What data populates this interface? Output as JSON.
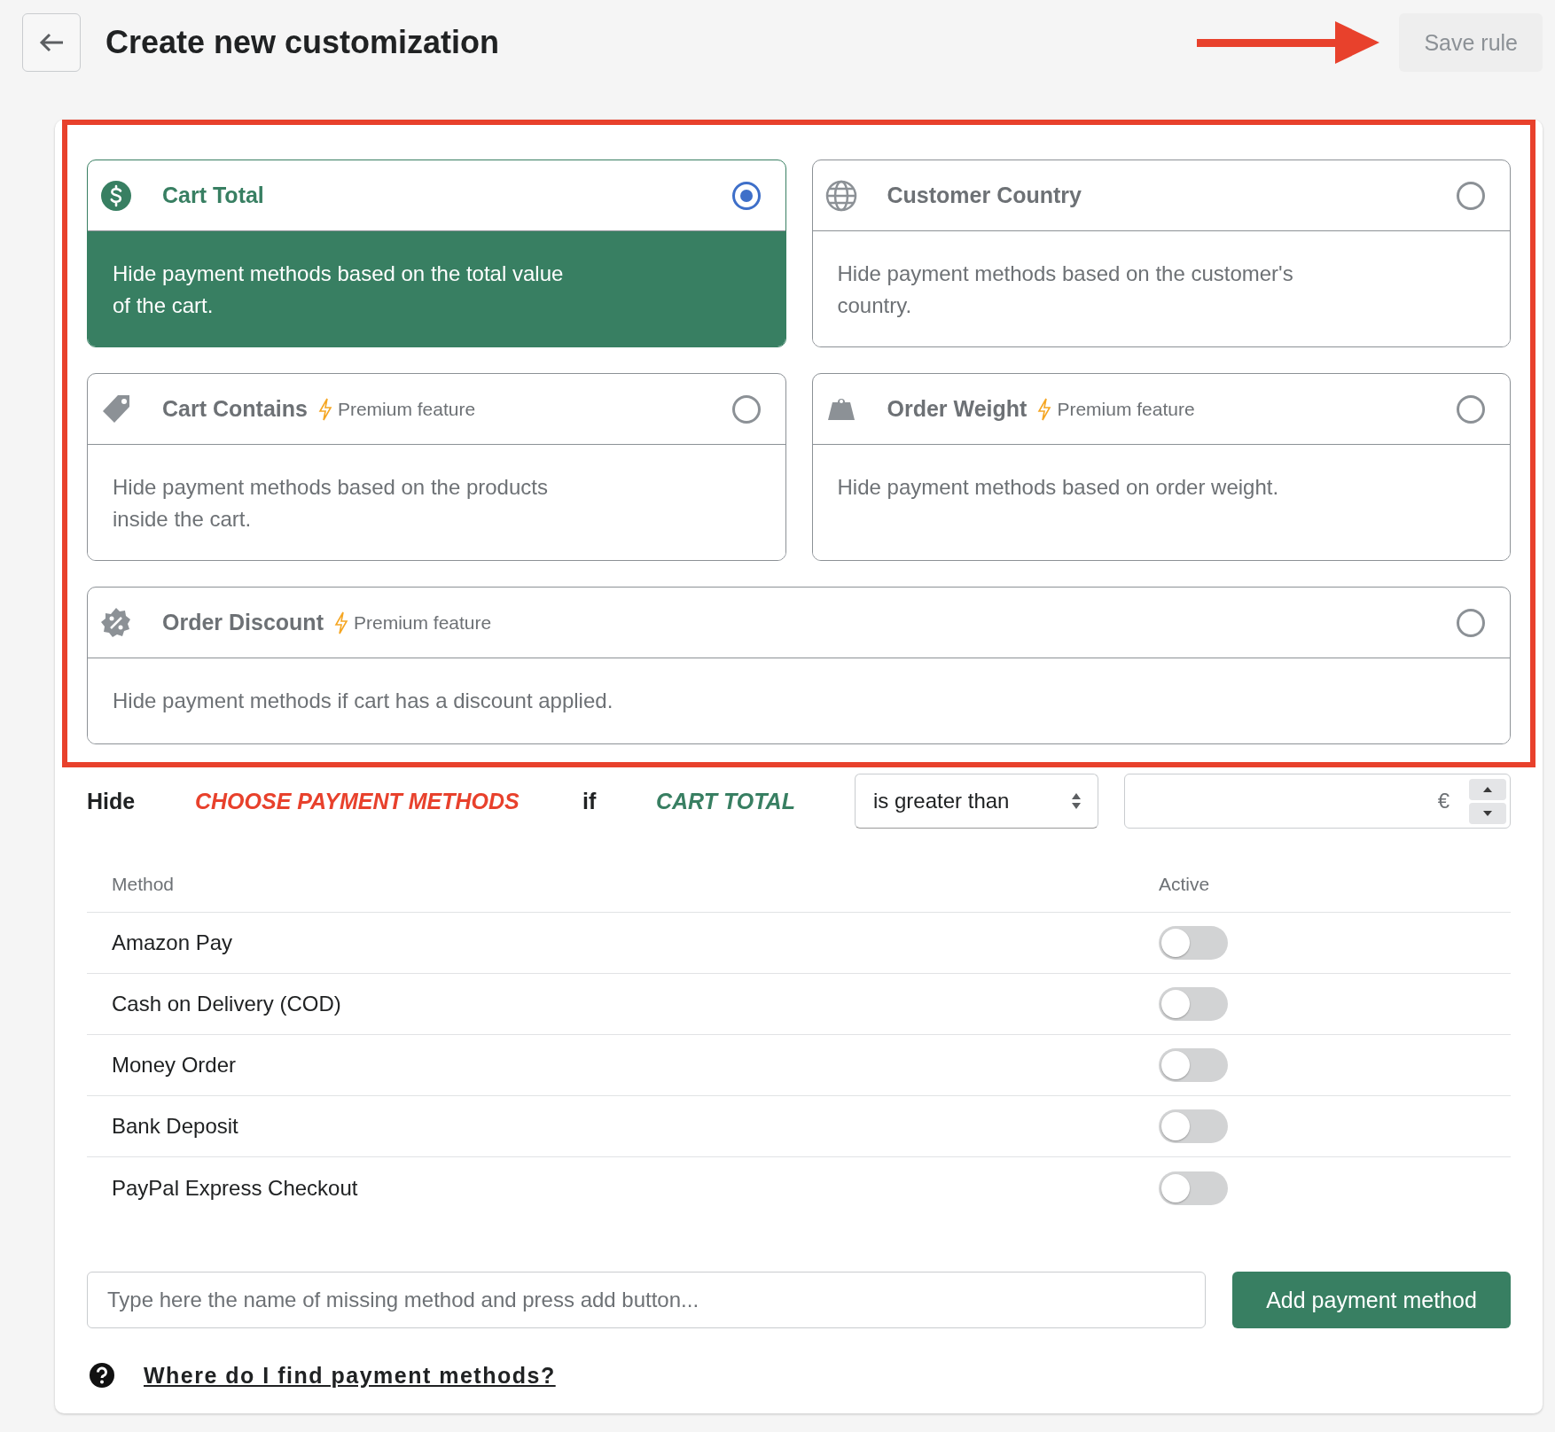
{
  "header": {
    "title": "Create new customization",
    "save_button": {
      "label": "Save rule",
      "disabled": true
    }
  },
  "conditions": [
    {
      "kind": "cart_total",
      "title": "Cart Total",
      "description": "Hide payment methods based on the total value of the cart.",
      "selected": true
    },
    {
      "kind": "customer_country",
      "title": "Customer Country",
      "description": "Hide payment methods based on the customer's country.",
      "selected": false
    },
    {
      "kind": "cart_contains",
      "title": "Cart Contains",
      "premium_label": "Premium feature",
      "description": "Hide payment methods based on the products inside the cart.",
      "selected": false
    },
    {
      "kind": "order_weight",
      "title": "Order Weight",
      "premium_label": "Premium feature",
      "description": "Hide payment methods based on order weight.",
      "selected": false
    },
    {
      "kind": "order_discount",
      "title": "Order Discount",
      "premium_label": "Premium feature",
      "description": "Hide payment methods if cart has a discount applied.",
      "selected": false
    }
  ],
  "rule": {
    "verb": "Hide",
    "methods_label": "CHOOSE PAYMENT METHODS",
    "connector": "if",
    "condition_label": "CART TOTAL",
    "operator": "is greater than",
    "currency": "€"
  },
  "table": {
    "columns": [
      "Method",
      "Active"
    ],
    "rows": [
      {
        "name": "Amazon Pay",
        "active": false
      },
      {
        "name": "Cash on Delivery (COD)",
        "active": false
      },
      {
        "name": "Money Order",
        "active": false
      },
      {
        "name": "Bank Deposit",
        "active": false
      },
      {
        "name": "PayPal Express Checkout",
        "active": false
      }
    ]
  },
  "add_method": {
    "placeholder": "Type here the name of missing method and press add button...",
    "button": "Add payment method"
  },
  "help_link": "Where do I find payment methods?"
}
